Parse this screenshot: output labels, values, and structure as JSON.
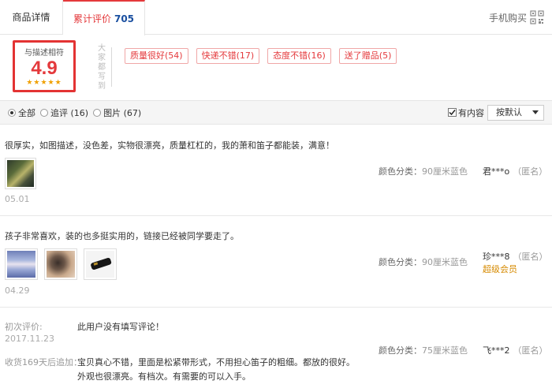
{
  "tabs": {
    "detail": "商品详情",
    "reviews_label": "累计评价",
    "reviews_count": "705",
    "mobile_buy": "手机购买"
  },
  "score": {
    "title": "与描述相符",
    "value": "4.9",
    "stars": "★★★★★"
  },
  "impressions": {
    "label": "大家都写到",
    "tags": [
      "质量很好(54)",
      "快递不错(17)",
      "态度不错(16)",
      "送了赠品(5)"
    ]
  },
  "filter": {
    "options": [
      {
        "label": "全部",
        "selected": true
      },
      {
        "label": "追评 (16)",
        "selected": false
      },
      {
        "label": "图片 (67)",
        "selected": false
      }
    ],
    "has_content_label": "有内容",
    "has_content_checked": true,
    "sort_label": "按默认"
  },
  "reviews": [
    {
      "text": "很厚实，如图描述，没色差，实物很漂亮，质量杠杠的，我的萧和笛子都能装，满意！",
      "date": "05.01",
      "sku_label": "颜色分类：",
      "sku_value": "90厘米蓝色",
      "user": "君***o",
      "anon": "（匿名）"
    },
    {
      "text": "孩子非常喜欢，装的也多挺实用的，链接已经被同学要走了。",
      "date": "04.29",
      "sku_label": "颜色分类：",
      "sku_value": "90厘米蓝色",
      "user": "珍***8",
      "anon": "（匿名）",
      "member": "超级会员"
    },
    {
      "initial_label": "初次评价:",
      "initial_date": "2017.11.23",
      "initial_text": "此用户没有填写评论！",
      "append_label": "收货169天后追加：",
      "append_lines": [
        "宝贝真心不错，里面是松紧带形式，不用担心笛子的粗细。都放的很好。",
        "外观也很漂亮。有档次。有需要的可以入手。"
      ],
      "sku_label": "颜色分类：",
      "sku_value": "75厘米蓝色",
      "user": "飞***2",
      "anon": "（匿名）"
    }
  ],
  "colors": {
    "accent": "#e4393c",
    "count": "#1a4fa0",
    "highlight_box": "#e33333",
    "star": "#f0a000",
    "member": "#d68a00"
  }
}
